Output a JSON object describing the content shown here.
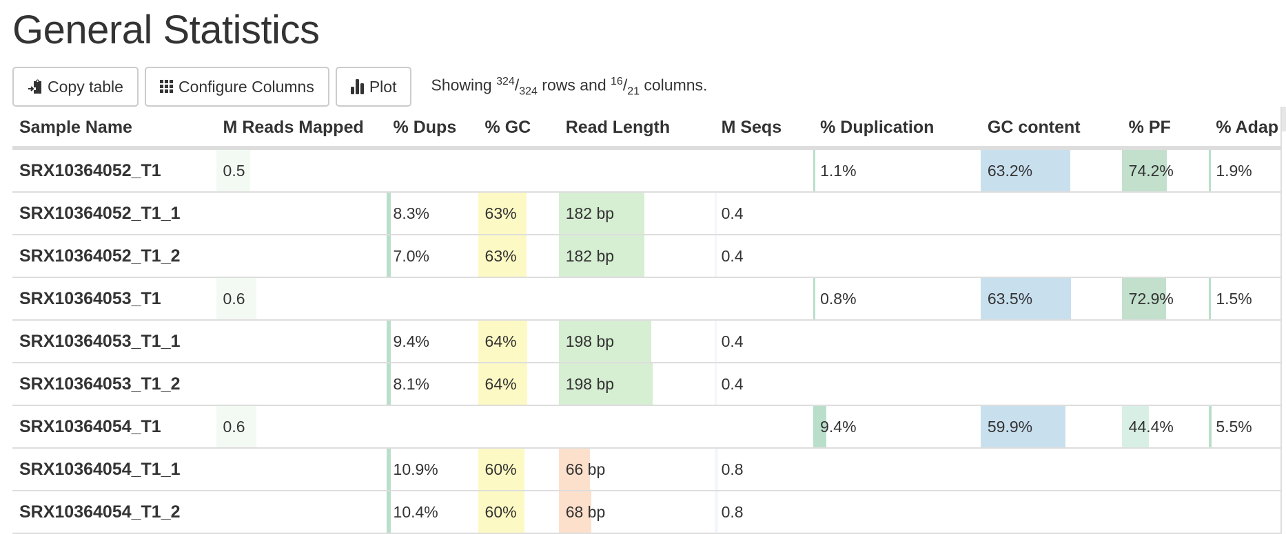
{
  "title": "General Statistics",
  "toolbar": {
    "copy_label": "Copy table",
    "copy_icon": "clipboard-copy-icon",
    "configure_label": "Configure Columns",
    "configure_icon": "grid-icon",
    "plot_label": "Plot",
    "plot_icon": "bar-chart-icon"
  },
  "status": {
    "prefix": "Showing",
    "rows_shown": "324",
    "rows_total": "324",
    "middle": "rows and",
    "cols_shown": "16",
    "cols_total": "21",
    "suffix": "columns."
  },
  "columns": [
    "Sample Name",
    "M Reads Mapped",
    "% Dups",
    "% GC",
    "Read Length",
    "M Seqs",
    "% Duplication",
    "GC content",
    "% PF",
    "% Adap"
  ],
  "colors": {
    "reads_mapped": "#f3faf3",
    "dups": "#b9dfca",
    "gc": "#fdf9c4",
    "read_length_long": "#d6eed2",
    "read_length_short": "#fde0cc",
    "m_seqs": "#f3f7fd",
    "duplication": "#b9dfca",
    "gc_content": "#c8dfee",
    "pf_high": "#c2e0cc",
    "pf_low": "#d8efe6",
    "adapter": "#b9dfca",
    "border": "#dddddd",
    "text": "#333333"
  },
  "rows": [
    {
      "name": "SRX10364052_T1",
      "reads_mapped": "0.5",
      "reads_mapped_frac": 0.22,
      "dups": "",
      "gc": "",
      "read_length": "",
      "m_seqs": "",
      "duplication": "1.1%",
      "duplication_frac": 0.011,
      "gc_content": "63.2%",
      "gc_content_frac": 0.632,
      "pf": "74.2%",
      "pf_frac": 0.742,
      "adapter": "1.9%",
      "adapter_frac": 0.019
    },
    {
      "name": "SRX10364052_T1_1",
      "reads_mapped": "",
      "dups": "8.3%",
      "dups_frac": 0.083,
      "gc": "63%",
      "gc_frac": 0.63,
      "read_length": "182 bp",
      "read_length_frac": 0.82,
      "read_length_kind": "long",
      "m_seqs": "0.4",
      "m_seqs_frac": 0.05,
      "duplication": "",
      "gc_content": "",
      "pf": "",
      "adapter": ""
    },
    {
      "name": "SRX10364052_T1_2",
      "reads_mapped": "",
      "dups": "7.0%",
      "dups_frac": 0.07,
      "gc": "63%",
      "gc_frac": 0.63,
      "read_length": "182 bp",
      "read_length_frac": 0.82,
      "read_length_kind": "long",
      "m_seqs": "0.4",
      "m_seqs_frac": 0.05,
      "duplication": "",
      "gc_content": "",
      "pf": "",
      "adapter": ""
    },
    {
      "name": "SRX10364053_T1",
      "reads_mapped": "0.6",
      "reads_mapped_frac": 0.26,
      "dups": "",
      "gc": "",
      "read_length": "",
      "m_seqs": "",
      "duplication": "0.8%",
      "duplication_frac": 0.008,
      "gc_content": "63.5%",
      "gc_content_frac": 0.635,
      "pf": "72.9%",
      "pf_frac": 0.729,
      "adapter": "1.5%",
      "adapter_frac": 0.015
    },
    {
      "name": "SRX10364053_T1_1",
      "reads_mapped": "",
      "dups": "9.4%",
      "dups_frac": 0.094,
      "gc": "64%",
      "gc_frac": 0.64,
      "read_length": "198 bp",
      "read_length_frac": 0.89,
      "read_length_kind": "long",
      "m_seqs": "0.4",
      "m_seqs_frac": 0.05,
      "duplication": "",
      "gc_content": "",
      "pf": "",
      "adapter": ""
    },
    {
      "name": "SRX10364053_T1_2",
      "reads_mapped": "",
      "dups": "8.1%",
      "dups_frac": 0.081,
      "gc": "64%",
      "gc_frac": 0.64,
      "read_length": "198 bp",
      "read_length_frac": 0.9,
      "read_length_kind": "long",
      "m_seqs": "0.4",
      "m_seqs_frac": 0.05,
      "duplication": "",
      "gc_content": "",
      "pf": "",
      "adapter": ""
    },
    {
      "name": "SRX10364054_T1",
      "reads_mapped": "0.6",
      "reads_mapped_frac": 0.26,
      "dups": "",
      "gc": "",
      "read_length": "",
      "m_seqs": "",
      "duplication": "9.4%",
      "duplication_frac": 0.094,
      "gc_content": "59.9%",
      "gc_content_frac": 0.599,
      "pf": "44.4%",
      "pf_frac": 0.444,
      "pf_kind": "low",
      "adapter": "5.5%",
      "adapter_frac": 0.055
    },
    {
      "name": "SRX10364054_T1_1",
      "reads_mapped": "",
      "dups": "10.9%",
      "dups_frac": 0.109,
      "gc": "60%",
      "gc_frac": 0.6,
      "read_length": "66 bp",
      "read_length_frac": 0.3,
      "read_length_kind": "short",
      "m_seqs": "0.8",
      "m_seqs_frac": 0.1,
      "duplication": "",
      "gc_content": "",
      "pf": "",
      "adapter": ""
    },
    {
      "name": "SRX10364054_T1_2",
      "reads_mapped": "",
      "dups": "10.4%",
      "dups_frac": 0.104,
      "gc": "60%",
      "gc_frac": 0.6,
      "read_length": "68 bp",
      "read_length_frac": 0.31,
      "read_length_kind": "short",
      "m_seqs": "0.8",
      "m_seqs_frac": 0.1,
      "duplication": "",
      "gc_content": "",
      "pf": "",
      "adapter": ""
    }
  ]
}
